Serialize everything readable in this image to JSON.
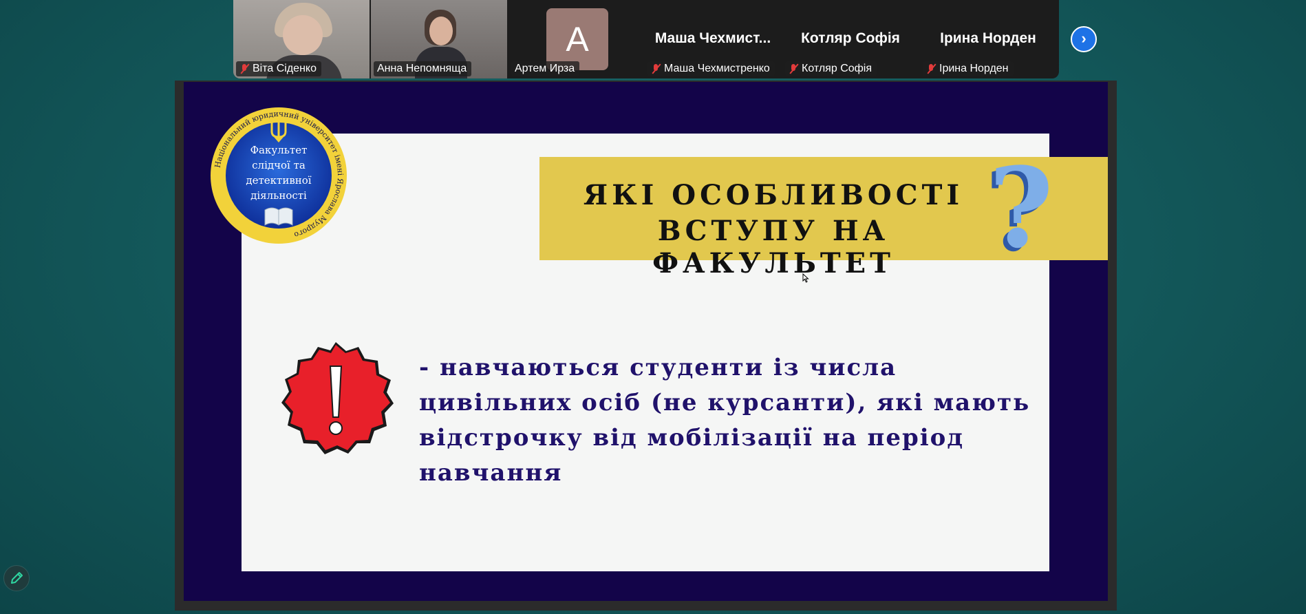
{
  "participants": [
    {
      "name": "Віта Сіденко",
      "muted": true,
      "has_video": true,
      "active": false
    },
    {
      "name": "Анна Непомняща",
      "muted": false,
      "has_video": true,
      "active": true
    },
    {
      "name": "Артем Ирза",
      "muted": false,
      "has_video": false,
      "avatar_letter": "A",
      "active": false
    },
    {
      "name": "Маша Чехмистренко",
      "display_name": "Маша  Чехмист...",
      "muted": true,
      "has_video": false
    },
    {
      "name": "Котляр Софія",
      "display_name": "Котляр Софія",
      "muted": true,
      "has_video": false
    },
    {
      "name": "Ірина Норден",
      "display_name": "Ірина Норден",
      "muted": true,
      "has_video": false
    }
  ],
  "slide": {
    "title_line1": "ЯКІ ОСОБЛИВОСТІ",
    "title_line2": "ВСТУПУ НА ФАКУЛЬТЕТ",
    "question_mark": "?",
    "logo": {
      "center_line1": "Факультет",
      "center_line2": "слідчої та",
      "center_line3": "детективної",
      "center_line4": "діяльності",
      "ring_text": "Національний юридичний університет імені Ярослава Мудрого"
    },
    "bullet": "- навчаються студенти із числа цивільних осіб (не курсанти), які мають відстрочку від мобілізації на період навчання"
  },
  "colors": {
    "slide_background": "#130449",
    "banner": "#e2c84e",
    "bullet_text": "#20126b",
    "active_speaker": "#20d49a",
    "nav_button": "#1e72e6"
  },
  "icons": [
    "mic-muted-icon",
    "chevron-right-icon",
    "pencil-icon",
    "exclamation-badge-icon",
    "trident-icon",
    "book-icon",
    "mouse-cursor-icon"
  ]
}
